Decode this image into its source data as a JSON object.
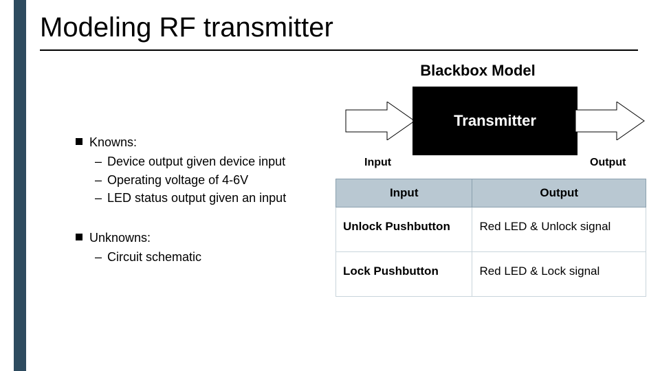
{
  "title": "Modeling RF transmitter",
  "knowns": {
    "label": "Knowns:",
    "items": [
      "Device output given device input",
      "Operating voltage of 4-6V",
      "LED status output given an input"
    ]
  },
  "unknowns": {
    "label": "Unknowns:",
    "items": [
      "Circuit schematic"
    ]
  },
  "blackbox": {
    "heading": "Blackbox Model",
    "box_label": "Transmitter",
    "input_label": "Input",
    "output_label": "Output"
  },
  "table": {
    "headers": {
      "input": "Input",
      "output": "Output"
    },
    "rows": [
      {
        "input": "Unlock Pushbutton",
        "output": "Red LED & Unlock signal"
      },
      {
        "input": "Lock Pushbutton",
        "output": "Red LED & Lock signal"
      }
    ]
  }
}
